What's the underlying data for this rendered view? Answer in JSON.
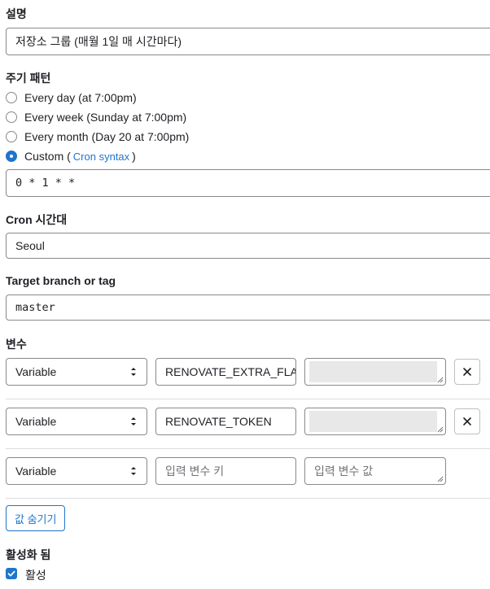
{
  "description": {
    "label": "설명",
    "value": "저장소 그룹 (매월 1일 매 시간마다)"
  },
  "interval": {
    "label": "주기 패턴",
    "options": [
      {
        "label": "Every day (at 7:00pm)",
        "selected": false
      },
      {
        "label": "Every week (Sunday at 7:00pm)",
        "selected": false
      },
      {
        "label": "Every month (Day 20 at 7:00pm)",
        "selected": false
      },
      {
        "label": "Custom (",
        "selected": true
      }
    ],
    "cron_link": "Cron syntax",
    "custom_suffix": ")",
    "cron_value": "0 * 1 * *"
  },
  "timezone": {
    "label": "Cron 시간대",
    "value": "Seoul"
  },
  "target": {
    "label": "Target branch or tag",
    "value": "master"
  },
  "variables": {
    "label": "변수",
    "rows": [
      {
        "type": "Variable",
        "key": "RENOVATE_EXTRA_FLAGS",
        "key_placeholder": "",
        "value_placeholder": ""
      },
      {
        "type": "Variable",
        "key": "RENOVATE_TOKEN",
        "key_placeholder": "",
        "value_placeholder": ""
      },
      {
        "type": "Variable",
        "key": "",
        "key_placeholder": "입력 변수 키",
        "value_placeholder": "입력 변수 값"
      }
    ],
    "hide_values_button": "값 숨기기"
  },
  "activated": {
    "label": "활성화 됨",
    "checkbox_label": "활성",
    "checked": true
  },
  "colors": {
    "accent": "#1f75cb",
    "border": "#89888d",
    "text": "#1f1e24"
  }
}
